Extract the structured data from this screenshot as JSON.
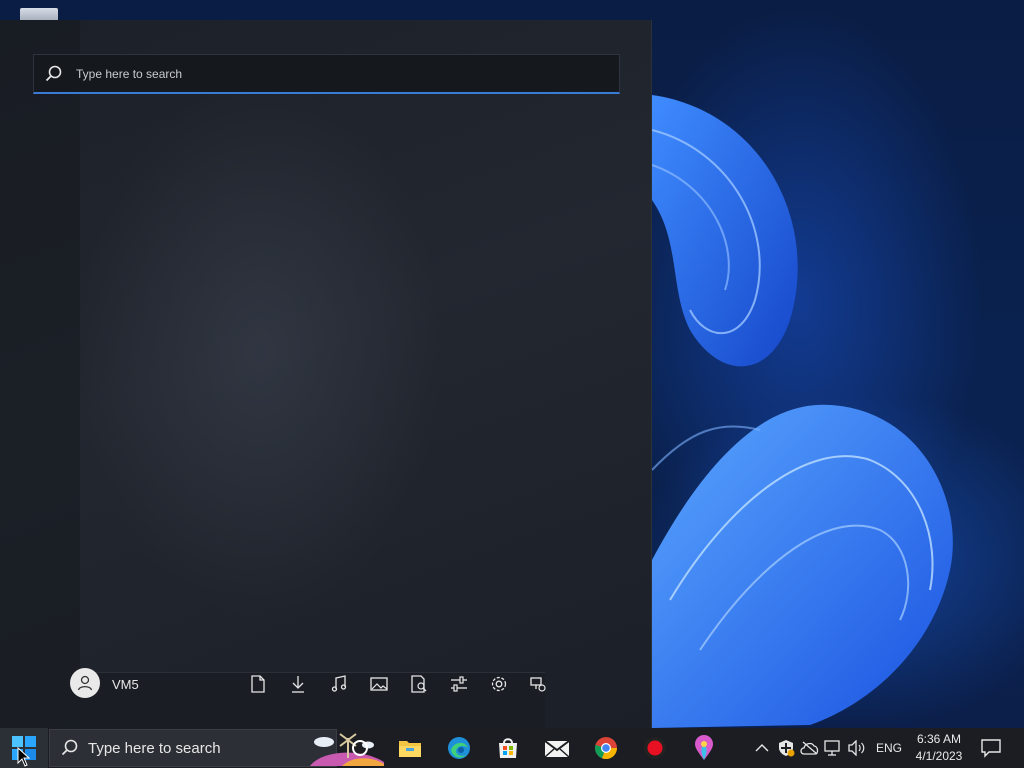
{
  "start_menu": {
    "search_placeholder": "Type here to search",
    "user_name": "VM5",
    "folders": [
      "documents-icon",
      "downloads-icon",
      "music-icon",
      "pictures-icon",
      "file-explorer-icon",
      "personal-folder-icon",
      "settings-icon",
      "network-icon"
    ]
  },
  "taskbar": {
    "search_text": "Type here to search",
    "apps": [
      "cortana-icon",
      "file-explorer-icon",
      "edge-icon",
      "store-icon",
      "mail-icon",
      "chrome-icon",
      "record-app-icon",
      "maps-icon"
    ],
    "tray": {
      "language": "ENG",
      "time": "6:36 AM",
      "date": "4/1/2023"
    }
  },
  "colors": {
    "accent": "#3a7bd5",
    "taskbar_bg": "#1b1d22",
    "start_bg": "#1f232b"
  }
}
